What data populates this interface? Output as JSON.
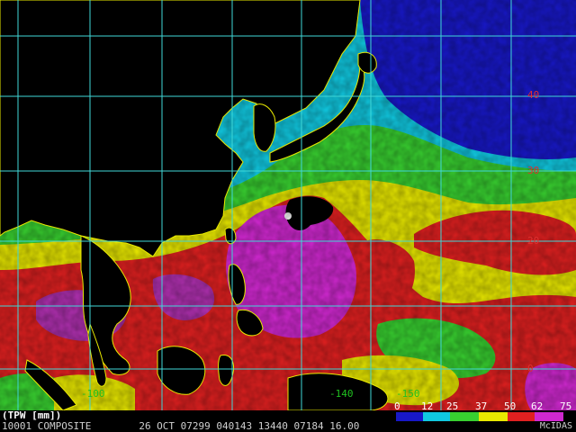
{
  "colors": {
    "graticule": "#40d8d8",
    "coastline": "#e8e800",
    "land": "#000000",
    "lat_label": "#e03030",
    "lon_label": "#20c020"
  },
  "lat_labels": [
    "40",
    "30",
    "20",
    "0"
  ],
  "lon_labels": [
    "-100",
    "-140",
    "-150"
  ],
  "scale": {
    "ticks": [
      "0",
      "12",
      "25",
      "37",
      "50",
      "62",
      "75"
    ],
    "colors": [
      "#1818c8",
      "#10c8e0",
      "#38d030",
      "#e8e800",
      "#e02020",
      "#d028d0"
    ]
  },
  "legend_label": "(TPW [mm])",
  "footer": {
    "id": "10001",
    "product": "COMPOSITE",
    "date": "26 OCT 07299",
    "time_code": "040143",
    "field1": "13440",
    "field2": "07184",
    "field3": "16.00",
    "source": "McIDAS"
  }
}
